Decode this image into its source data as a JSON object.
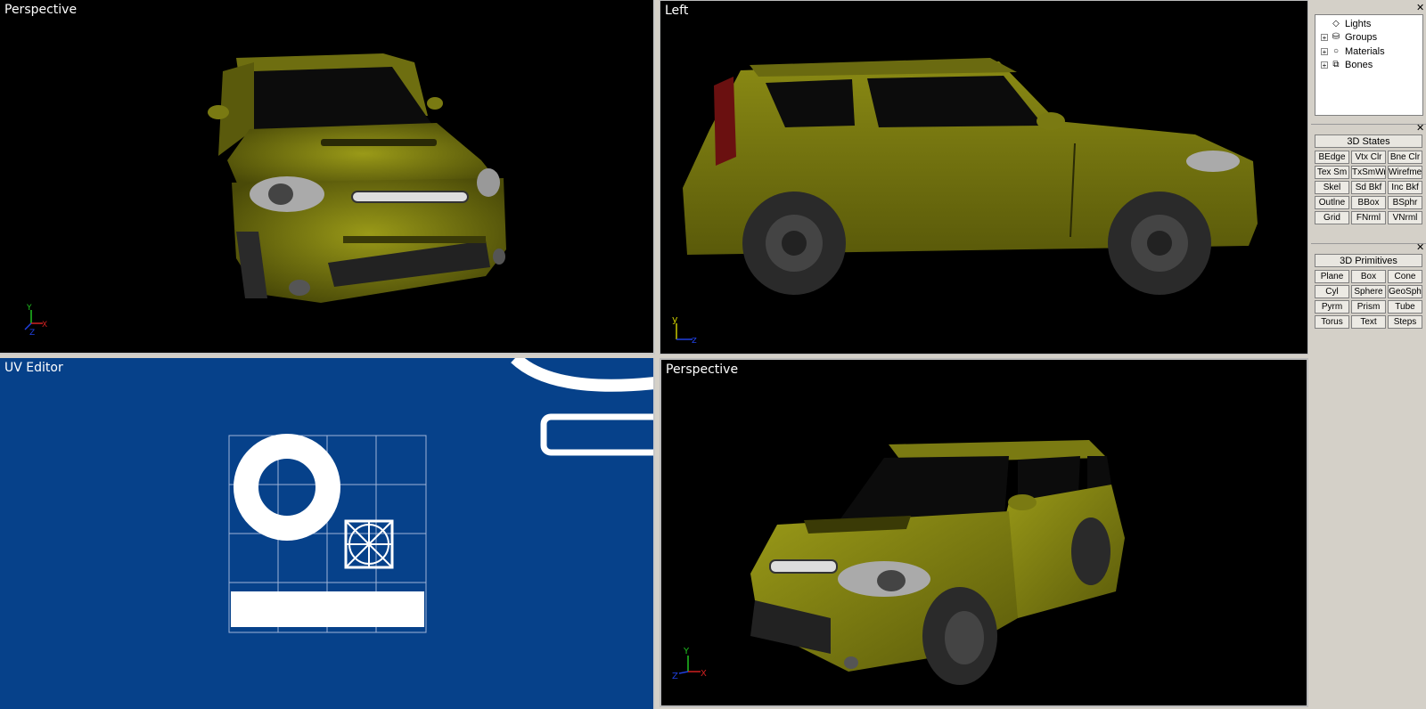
{
  "viewports": {
    "top_left": {
      "label": "Perspective",
      "axis": [
        "Y",
        "X",
        "Z"
      ]
    },
    "top_right": {
      "label": "Left",
      "axis": [
        "y",
        "z"
      ]
    },
    "bottom_left": {
      "label": "UV Editor"
    },
    "bottom_right": {
      "label": "Perspective",
      "axis": [
        "Y",
        "Z",
        "X"
      ]
    }
  },
  "scene_tree": {
    "items": [
      {
        "label": "Lights",
        "icon": "diamond-icon",
        "expandable": false
      },
      {
        "label": "Groups",
        "icon": "cylinder-icon",
        "expandable": true
      },
      {
        "label": "Materials",
        "icon": "sphere-icon",
        "expandable": true
      },
      {
        "label": "Bones",
        "icon": "bone-box-icon",
        "expandable": true
      }
    ]
  },
  "states_panel": {
    "title": "3D States",
    "buttons": [
      "BEdge",
      "Vtx Clr",
      "Bne Clr",
      "Tex Sm",
      "TxSmWr",
      "Wirefme",
      "Skel",
      "Sd Bkf",
      "Inc Bkf",
      "Outlne",
      "BBox",
      "BSphr",
      "Grid",
      "FNrml",
      "VNrml"
    ]
  },
  "primitives_panel": {
    "title": "3D Primitives",
    "buttons": [
      "Plane",
      "Box",
      "Cone",
      "Cyl",
      "Sphere",
      "GeoSph",
      "Pyrm",
      "Prism",
      "Tube",
      "Torus",
      "Text",
      "Steps"
    ]
  },
  "colors": {
    "car_body": "#8a8a12",
    "uv_background": "#06418a",
    "axis_x": "#d02020",
    "axis_y": "#20c020",
    "axis_z": "#2040e0"
  }
}
